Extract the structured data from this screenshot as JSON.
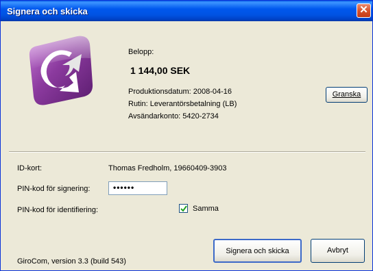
{
  "window": {
    "title": "Signera och skicka",
    "close_glyph": "✕"
  },
  "payment": {
    "amount_label": "Belopp:",
    "amount_value": "1 144,00 SEK",
    "production_date": "Produktionsdatum: 2008-04-16",
    "routine": "Rutin: Leverantörsbetalning (LB)",
    "sender_account": "Avsändarkonto: 5420-2734"
  },
  "buttons": {
    "review_label": "Granska",
    "sign_send_label": "Signera och skicka",
    "cancel_label": "Avbryt"
  },
  "form": {
    "id_card_label": "ID-kort:",
    "id_card_value": "Thomas Fredholm, 19660409-3903",
    "pin_sign_label": "PIN-kod för signering:",
    "pin_sign_value": "••••••",
    "pin_ident_label": "PIN-kod för identifiering:",
    "same_label": "Samma",
    "same_checked": true
  },
  "footer": {
    "version_text": "GiroCom, version  3.3 (build 543)"
  },
  "icons": {
    "app_logo": "girocom-logo-icon",
    "close": "close-icon",
    "check": "checkmark-icon"
  },
  "colors": {
    "titlebar": "#0058ee",
    "close": "#d9532b",
    "logo": "#8b3a9e",
    "background": "#ece9d8"
  }
}
